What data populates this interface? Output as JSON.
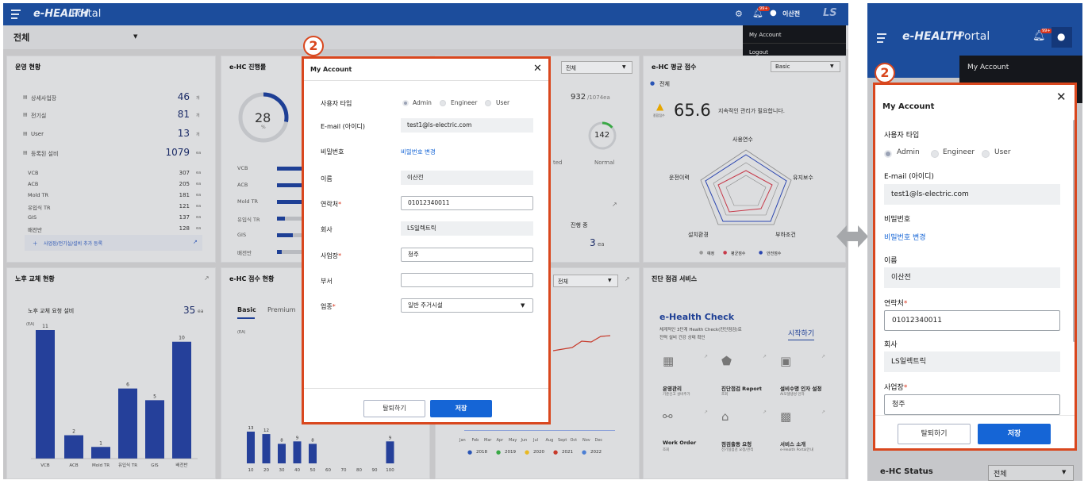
{
  "portal": {
    "brand_e": "e-HEALTH",
    "brand_portal": "Portal",
    "user_name": "이산전",
    "ls_logo": "LS",
    "notif_badge": "99+"
  },
  "filter": {
    "selected": "전체"
  },
  "user_menu": {
    "items": [
      "My Account",
      "Logout"
    ]
  },
  "ops": {
    "title": "운영 현황",
    "rows": [
      {
        "label": "상세사업장",
        "value": "46",
        "unit": "개"
      },
      {
        "label": "전기실",
        "value": "81",
        "unit": "개"
      },
      {
        "label": "User",
        "value": "13",
        "unit": "개"
      },
      {
        "label": "등록된 설비",
        "value": "1079",
        "unit": "ea"
      }
    ],
    "equip": [
      {
        "label": "VCB",
        "value": "307",
        "unit": "ea"
      },
      {
        "label": "ACB",
        "value": "205",
        "unit": "ea"
      },
      {
        "label": "Mold TR",
        "value": "181",
        "unit": "ea"
      },
      {
        "label": "유입식 TR",
        "value": "121",
        "unit": "ea"
      },
      {
        "label": "GIS",
        "value": "137",
        "unit": "ea"
      },
      {
        "label": "배전반",
        "value": "128",
        "unit": "ea"
      }
    ],
    "add_link": "사업장/전기실/설비 추가 등록"
  },
  "progress": {
    "title": "e-HC 진행률",
    "percent": "28",
    "pct_sign": "%",
    "labels": [
      "VCB",
      "ACB",
      "Mold TR",
      "유입식 TR",
      "GIS",
      "배전반"
    ],
    "total": "932",
    "total_of": "/1074ea",
    "count": "142",
    "normal": "Normal",
    "ted": "ted",
    "in_progress_label": "진행 중",
    "in_progress_value": "3",
    "in_progress_unit": "ea",
    "select": "전체"
  },
  "score": {
    "title": "e-HC 평균 점수",
    "select": "Basic",
    "filter": "전체",
    "value": "65.6",
    "badge": "종합점수",
    "message": "지속적인 관리가 필요합니다.",
    "axes": [
      "사용연수",
      "유지보수",
      "부하조건",
      "설치환경",
      "운전이력"
    ],
    "legend": [
      "예정",
      "평균점수",
      "안전점수"
    ]
  },
  "aging": {
    "title": "노후 교체 현황",
    "subtitle": "노후 교체 요청 설비",
    "total": "35",
    "unit": "ea",
    "yunit": "(EA)",
    "chart_data": {
      "type": "bar",
      "categories": [
        "VCB",
        "ACB",
        "Mold TR",
        "유입식 TR",
        "GIS",
        "배전반"
      ],
      "values": [
        11,
        2,
        1,
        6,
        5,
        10
      ]
    }
  },
  "hc_score": {
    "title": "e-HC 점수 현황",
    "tabs": [
      "Basic",
      "Premium"
    ],
    "yunit": "(EA)",
    "chart_data": {
      "type": "bar",
      "categories": [
        "10",
        "20",
        "30",
        "40",
        "50",
        "60",
        "70",
        "80",
        "90",
        "100"
      ],
      "values": [
        13,
        12,
        8,
        9,
        8,
        null,
        null,
        null,
        null,
        9
      ]
    }
  },
  "trend": {
    "select": "전체",
    "months": [
      "Jan",
      "Feb",
      "Mar",
      "Apr",
      "May",
      "Jun",
      "Jul",
      "Aug",
      "Sept",
      "Oct",
      "Nov",
      "Dec"
    ],
    "years": [
      "2018",
      "2019",
      "2020",
      "2021",
      "2022"
    ],
    "colors": [
      "#2a55b5",
      "#39a845",
      "#e8b923",
      "#c73a2b",
      "#4c7fd4"
    ]
  },
  "service": {
    "title": "진단 점검 서비스",
    "hc_title": "e-Health Check",
    "hc_desc1": "체계적인 3단계 Health Check(진단점검)로",
    "hc_desc2": "전력 설비 건강 상태 확인",
    "start": "시작하기",
    "items": [
      {
        "title": "운영관리",
        "sub": "기준신고 설비추가"
      },
      {
        "title": "진단점검 Report",
        "sub": "조회"
      },
      {
        "title": "설비수명 인자 설정",
        "sub": "AI모델생성 인자"
      },
      {
        "title": "Work Order",
        "sub": "조회"
      },
      {
        "title": "점검출동 요청",
        "sub": "전기실점검 요청/견적"
      },
      {
        "title": "서비스 소개",
        "sub": "e-Health Portal안내"
      }
    ]
  },
  "callout": "2",
  "account": {
    "title": "My Account",
    "user_type_label": "사용자 타입",
    "user_types": [
      "Admin",
      "Engineer",
      "User"
    ],
    "email_label": "E-mail (아이디)",
    "email": "test1@ls-electric.com",
    "pw_label": "비밀번호",
    "pw_link": "비밀번호 변경",
    "name_label": "이름",
    "name": "이산전",
    "phone_label": "연락처",
    "phone": "01012340011",
    "company_label": "회사",
    "company": "LS일렉트릭",
    "site_label": "사업장",
    "site": "청주",
    "dept_label": "부서",
    "dept": "",
    "industry_label": "업종",
    "industry": "일반 주거시설",
    "withdraw": "탈퇴하기",
    "save": "저장"
  },
  "mobile": {
    "bottom_label": "e-HC Status",
    "bottom_select": "전체"
  }
}
